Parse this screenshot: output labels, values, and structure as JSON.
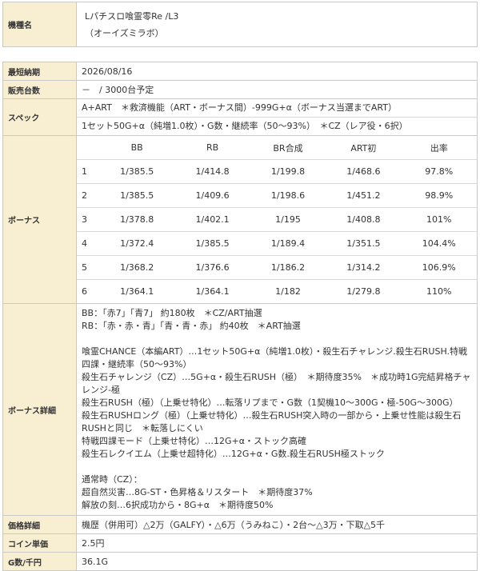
{
  "title_row": {
    "label": "機種名",
    "line1": "Lパチスロ喰霊零Re /L3",
    "line2": "（オーイズミラボ）"
  },
  "rows": {
    "release": {
      "label": "最短納期",
      "value": "2026/08/16"
    },
    "sales": {
      "label": "販売台数",
      "value": "－　/ 3000台予定"
    },
    "spec": {
      "label": "スペック",
      "line1": "A+ART　＊救済機能（ART・ボーナス間）-999G+α（ボーナス当選までART）",
      "line2": "1セット50G+α（純増1.0枚）・G数・継続率（50～93%）　＊CZ（レア役・6択）"
    },
    "bonus": {
      "label": "ボーナス",
      "headers": [
        "",
        "BB",
        "RB",
        "BR合成",
        "ART初",
        "出率"
      ],
      "table": [
        [
          "1",
          "1/385.5",
          "1/414.8",
          "1/199.8",
          "1/468.6",
          "97.8%"
        ],
        [
          "2",
          "1/385.5",
          "1/409.6",
          "1/198.6",
          "1/451.2",
          "98.9%"
        ],
        [
          "3",
          "1/378.8",
          "1/402.1",
          "1/195",
          "1/408.8",
          "101%"
        ],
        [
          "4",
          "1/372.4",
          "1/385.5",
          "1/189.4",
          "1/351.5",
          "104.4%"
        ],
        [
          "5",
          "1/368.2",
          "1/376.6",
          "1/186.2",
          "1/314.2",
          "106.9%"
        ],
        [
          "6",
          "1/364.1",
          "1/364.1",
          "1/182",
          "1/279.8",
          "110%"
        ]
      ]
    },
    "detail": {
      "label": "ボーナス詳細",
      "lines": [
        "BB：「赤7」「青7」 約180枚　＊CZ/ART抽選",
        "RB：「赤・赤・青」「青・青・赤」 約40枚　＊ART抽選",
        "",
        "喰霊CHANCE（本編ART）…1セット50G+α（純増1.0枚）・殺生石チャレンジ.殺生石RUSH.特戦四課・継続率（50～93%）",
        "殺生石チャレンジ（CZ）…5G+α・殺生石RUSH（極）　＊期待度35%　＊成功時1G完結昇格チャレンジ-極",
        "殺生石RUSH（極）（上乗せ特化）…転落リプまで・G数（1契機10～300G・極-50G～300G）",
        "殺生石RUSHロング（極）（上乗せ特化）…殺生石RUSH突入時の一部から・上乗せ性能は殺生石RUSHと同じ　＊転落しにくい",
        "特戦四課モード（上乗せ特化）…12G+α・ストック高確",
        "殺生石レクイエム（上乗せ超特化）…12G+α・G数.殺生石RUSH極ストック",
        "",
        "通常時（CZ）：",
        "超自然災害…8G-ST・色昇格＆リスタート　＊期待度37%",
        "解放の刻…6択成功から・8G+α　＊期待度50%"
      ]
    },
    "price": {
      "label": "価格詳細",
      "value": "機歴（併用可）△2万（GALFY）・△6万（うみねこ）・2台～△3万・下取△5千"
    },
    "coin": {
      "label": "コイン単価",
      "value": "2.5円"
    },
    "games": {
      "label": "G数/千円",
      "value": "36.1G"
    }
  },
  "colors": {
    "header_bg": "#f8efd2",
    "border": "#c9c9c9",
    "price_text": "#c0392b"
  }
}
